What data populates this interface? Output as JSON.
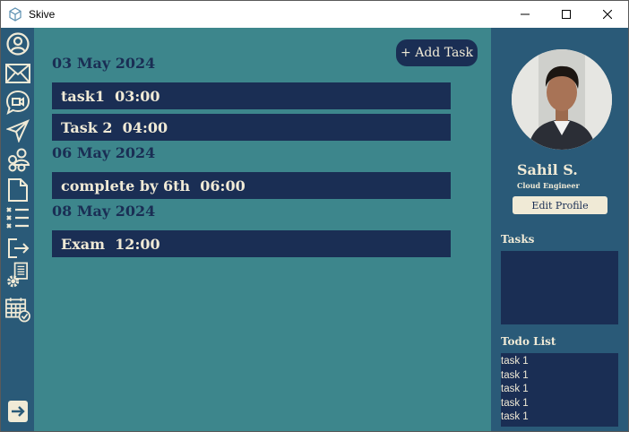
{
  "window": {
    "title": "Skive"
  },
  "nav": {
    "items": [
      "profile-icon",
      "mail-icon",
      "video-chat-icon",
      "send-icon",
      "group-icon",
      "document-icon",
      "checklist-icon",
      "logout-icon",
      "settings-docs-icon",
      "calendar-check-icon"
    ],
    "bottom": "expand-arrow-icon"
  },
  "main": {
    "add_task_label": "+ Add Task",
    "groups": [
      {
        "date": "03 May 2024",
        "tasks": [
          "task1  03:00",
          "Task 2  04:00"
        ]
      },
      {
        "date": "06 May 2024",
        "tasks": [
          "complete by 6th  06:00"
        ]
      },
      {
        "date": "08 May 2024",
        "tasks": [
          "Exam  12:00"
        ]
      }
    ]
  },
  "profile": {
    "name": "Sahil S.",
    "role": "Cloud Engineer",
    "edit_label": "Edit Profile"
  },
  "sidebar": {
    "tasks_heading": "Tasks",
    "todo_heading": "Todo List",
    "todo_items": [
      "task 1",
      "task 1",
      "task 1",
      "task 1",
      "task 1"
    ]
  },
  "colors": {
    "nav_bg": "#2a5a78",
    "main_bg": "#3d868c",
    "navy": "#1a2e54",
    "cream": "#f0ead6"
  }
}
